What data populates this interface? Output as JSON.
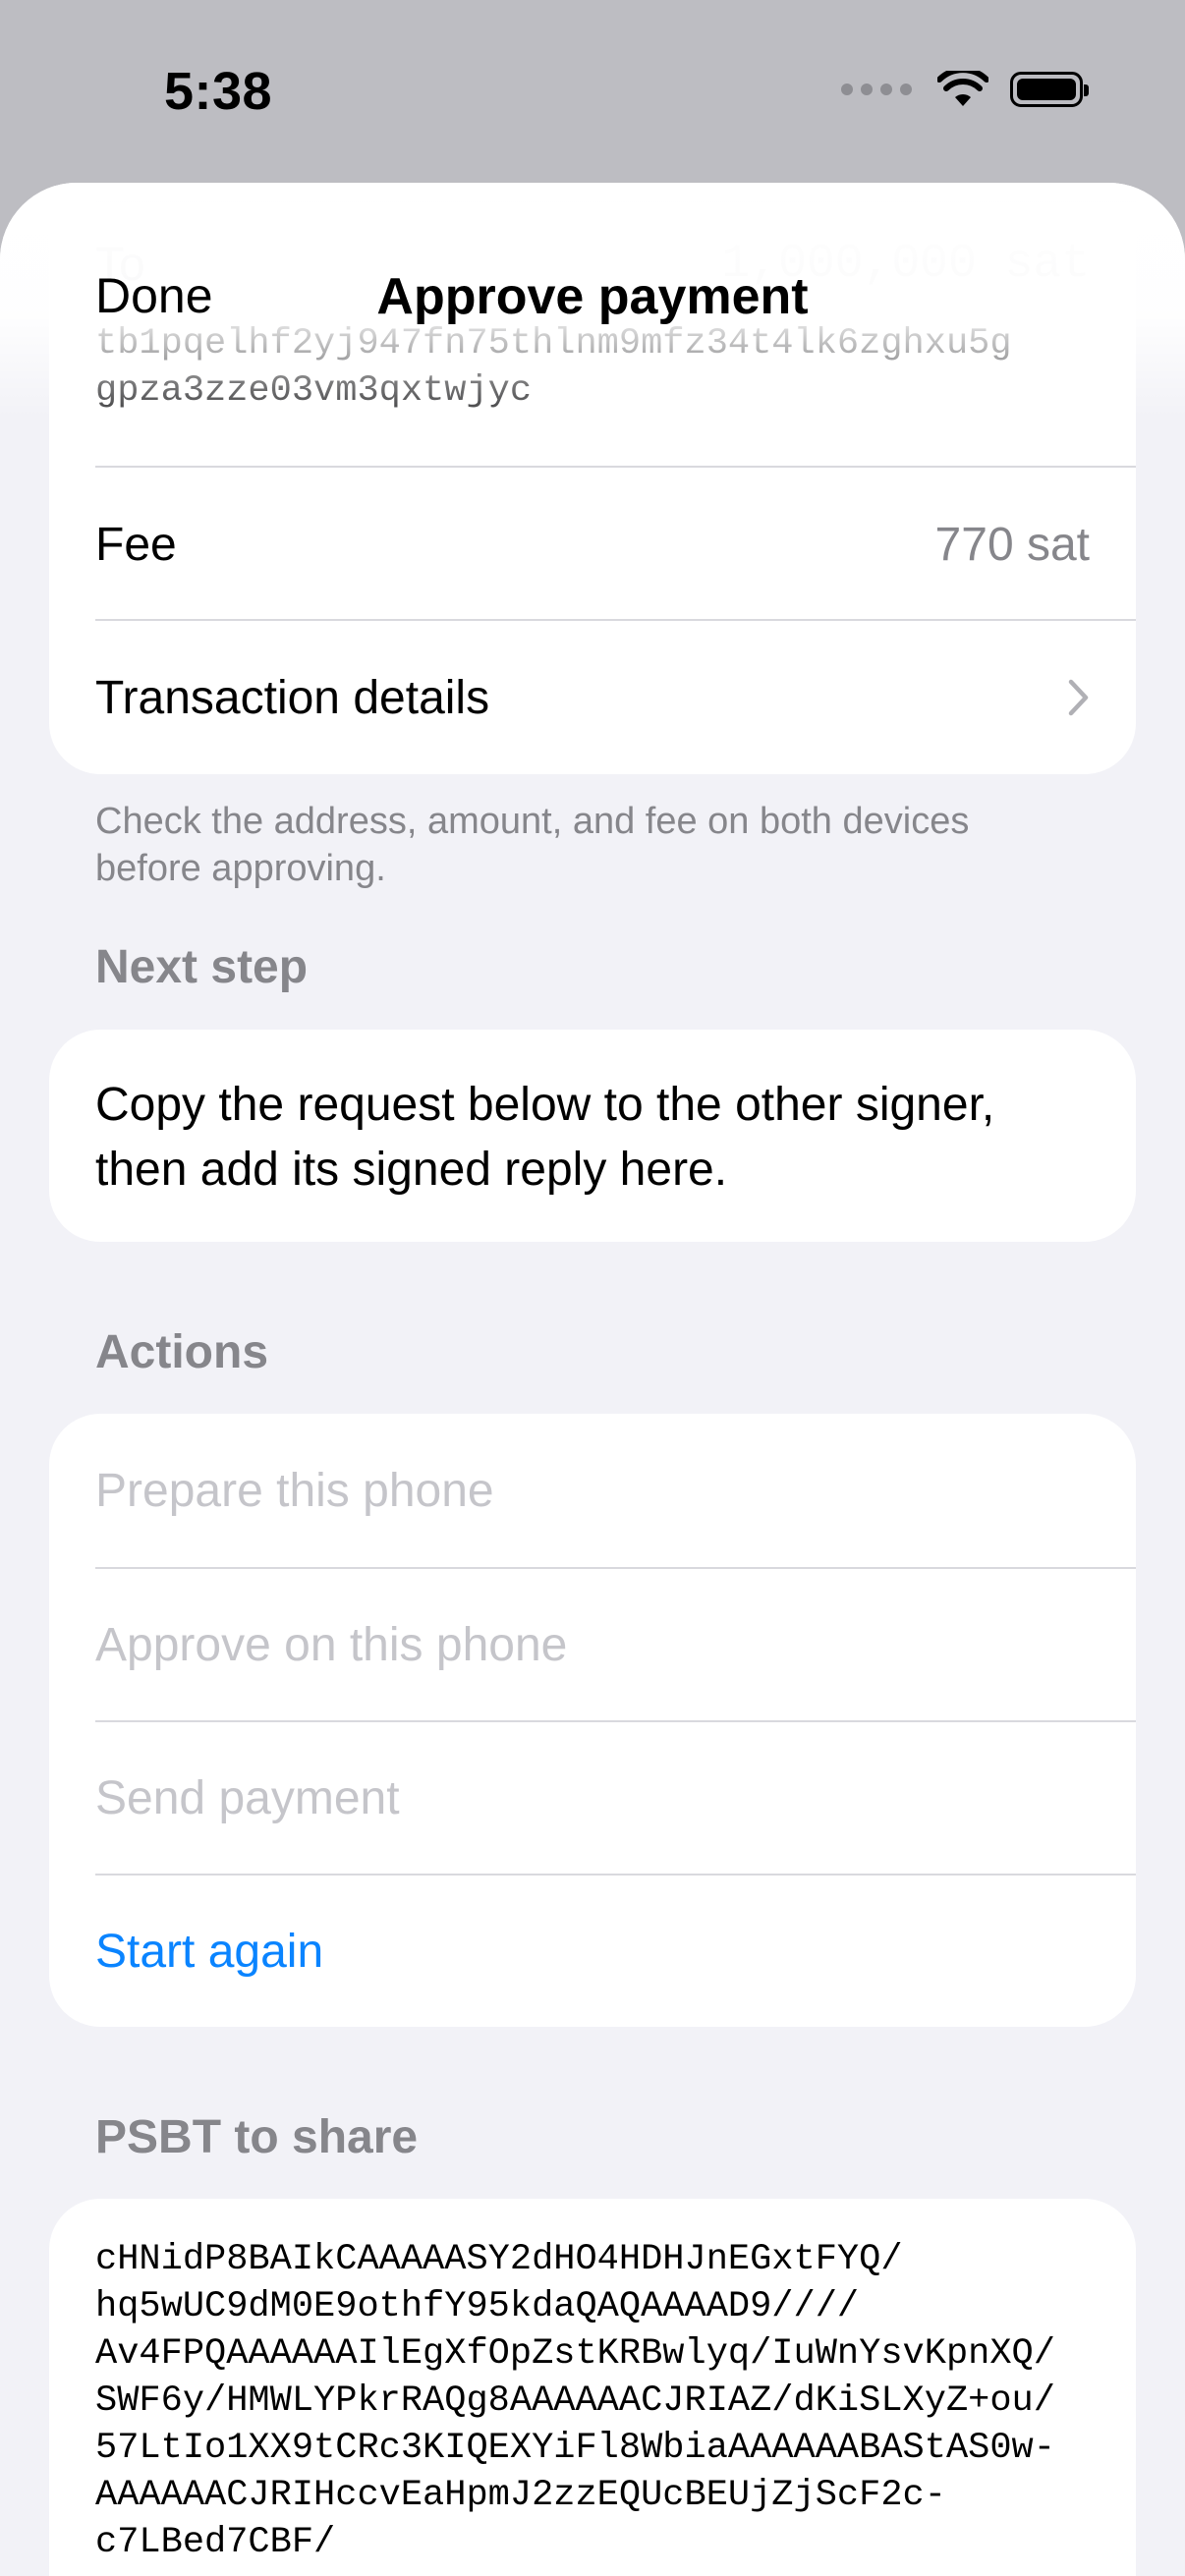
{
  "status_bar": {
    "time": "5:38"
  },
  "nav": {
    "done_label": "Done",
    "title": "Approve payment"
  },
  "summary": {
    "amount_label": "To",
    "amount_value": "1,000,000 sat",
    "address_line1": "tb1pqelhf2yj947fn75thlnm9mfz34t4lk6zghxu5g",
    "address_line2": "gpza3zze03vm3qxtwjyc",
    "fee_label": "Fee",
    "fee_value": "770 sat",
    "details_label": "Transaction details",
    "footer": "Check the address, amount, and fee on both devices before approving."
  },
  "next_step": {
    "header": "Next step",
    "text": "Copy the request below to the other signer, then add its signed reply here."
  },
  "actions": {
    "header": "Actions",
    "prepare_label": "Prepare this phone",
    "approve_label": "Approve on this phone",
    "send_label": "Send payment",
    "start_again_label": "Start again"
  },
  "psbt": {
    "header": "PSBT to share",
    "lines": [
      "cHNidP8BAIkCAAAAASY2dHO4HDHJnEGxtFYQ/",
      "hq5wUC9dM0E9othfY95kdaQAQAAAAD9////",
      "Av4FPQAAAAAAIlEgXfOpZstKRBwlyq/IuWnYsvKpnXQ/",
      "SWF6y/HMWLYPkrRAQg8AAAAAACJRIAZ/dKiSLXyZ+ou/",
      "57LtIo1XX9tCRc3KIQEXYiFl8WbiaAAAAAABAStAS0w-",
      "AAAAAACJRIHccvEaHpmJ2zzEQUcBEUjZjScF2c-",
      "c7LBed7CBF/"
    ]
  },
  "colors": {
    "accent": "#0a84ff",
    "secondary": "#86868b",
    "disabled": "#c5c5ca"
  }
}
